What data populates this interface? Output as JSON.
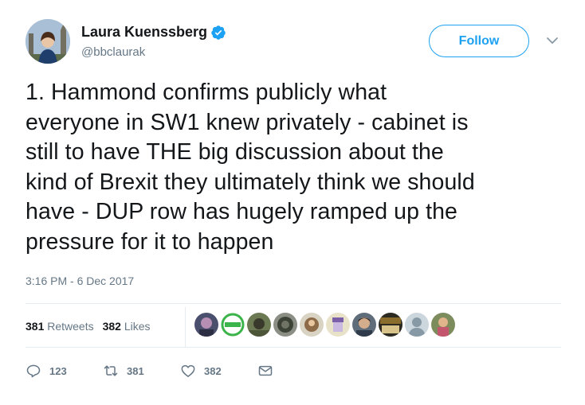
{
  "author": {
    "display_name": "Laura Kuenssberg",
    "handle": "@bbclaurak",
    "verified": true
  },
  "follow_label": "Follow",
  "tweet_text": "1. Hammond confirms publicly what\neveryone in SW1 knew privately - cabinet is\nstill to have THE big discussion about the\nkind of Brexit they ultimately think we should\nhave - DUP row has hugely ramped up the\npressure for it to  happen",
  "timestamp": "3:16 PM - 6 Dec 2017",
  "stats": {
    "retweets_count": "381",
    "retweets_label": "Retweets",
    "likes_count": "382",
    "likes_label": "Likes"
  },
  "actions": {
    "reply_count": "123",
    "retweet_count": "381",
    "like_count": "382"
  },
  "icons": [
    "verified-badge-icon",
    "chevron-down-icon",
    "reply-icon",
    "retweet-icon",
    "heart-icon",
    "envelope-icon"
  ],
  "colors": {
    "accent": "#1da1f2",
    "text": "#14171a",
    "muted": "#657786",
    "divider": "#e6ecf0"
  }
}
